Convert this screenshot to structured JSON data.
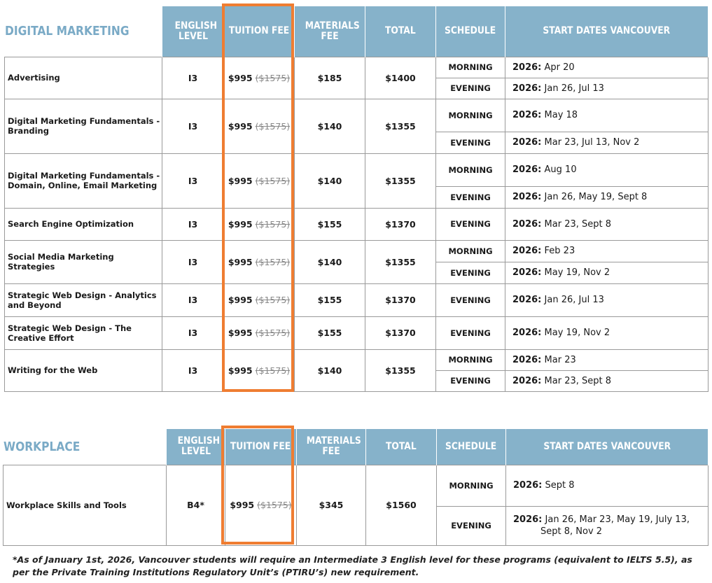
{
  "section1": {
    "title": "DIGITAL MARKETING",
    "headers": [
      "ENGLISH LEVEL",
      "TUITION FEE",
      "MATERIALS FEE",
      "TOTAL",
      "SCHEDULE",
      "START DATES VANCOUVER"
    ],
    "rows": [
      {
        "name": "Advertising",
        "level": "I3",
        "fee": "$995",
        "old_fee": "($1575)",
        "materials": "$185",
        "total": "$1400",
        "schedule": [
          {
            "time": "MORNING",
            "year": "2026:",
            "dates": "Apr 20"
          },
          {
            "time": "EVENING",
            "year": "2026:",
            "dates": "Jan 26, Jul 13"
          }
        ]
      },
      {
        "name": "Digital Marketing Fundamentals - Branding",
        "level": "I3",
        "fee": "$995",
        "old_fee": "($1575)",
        "materials": "$140",
        "total": "$1355",
        "schedule": [
          {
            "time": "MORNING",
            "year": "2026:",
            "dates": "May 18"
          },
          {
            "time": "EVENING",
            "year": "2026:",
            "dates": "Mar 23, Jul 13, Nov 2"
          }
        ]
      },
      {
        "name": "Digital Marketing Fundamentals - Domain, Online, Email Marketing",
        "level": "I3",
        "fee": "$995",
        "old_fee": "($1575)",
        "materials": "$140",
        "total": "$1355",
        "schedule": [
          {
            "time": "MORNING",
            "year": "2026:",
            "dates": "Aug 10"
          },
          {
            "time": "EVENING",
            "year": "2026:",
            "dates": "Jan 26, May 19, Sept 8"
          }
        ]
      },
      {
        "name": "Search Engine Optimization",
        "level": "I3",
        "fee": "$995",
        "old_fee": "($1575)",
        "materials": "$155",
        "total": "$1370",
        "schedule": [
          {
            "time": "EVENING",
            "year": "2026:",
            "dates": "Mar 23, Sept 8"
          }
        ]
      },
      {
        "name": "Social Media Marketing Strategies",
        "level": "I3",
        "fee": "$995",
        "old_fee": "($1575)",
        "materials": "$140",
        "total": "$1355",
        "schedule": [
          {
            "time": "MORNING",
            "year": "2026:",
            "dates": "Feb 23"
          },
          {
            "time": "EVENING",
            "year": "2026:",
            "dates": "May 19, Nov 2"
          }
        ]
      },
      {
        "name": "Strategic Web Design - Analytics and Beyond",
        "level": "I3",
        "fee": "$995",
        "old_fee": "($1575)",
        "materials": "$155",
        "total": "$1370",
        "schedule": [
          {
            "time": "EVENING",
            "year": "2026:",
            "dates": "Jan 26, Jul 13"
          }
        ]
      },
      {
        "name": "Strategic Web Design - The Creative Effort",
        "level": "I3",
        "fee": "$995",
        "old_fee": "($1575)",
        "materials": "$155",
        "total": "$1370",
        "schedule": [
          {
            "time": "EVENING",
            "year": "2026:",
            "dates": "May 19, Nov 2"
          }
        ]
      },
      {
        "name": "Writing for the Web",
        "level": "I3",
        "fee": "$995",
        "old_fee": "($1575)",
        "materials": "$140",
        "total": "$1355",
        "schedule": [
          {
            "time": "MORNING",
            "year": "2026:",
            "dates": "Mar 23"
          },
          {
            "time": "EVENING",
            "year": "2026:",
            "dates": "Mar 23, Sept 8"
          }
        ]
      }
    ]
  },
  "section2": {
    "title": "WORKPLACE",
    "headers": [
      "ENGLISH LEVEL",
      "TUITION FEE",
      "MATERIALS FEE",
      "TOTAL",
      "SCHEDULE",
      "START DATES VANCOUVER"
    ],
    "rows": [
      {
        "name": "Workplace Skills and Tools",
        "level": "B4*",
        "fee": "$995",
        "old_fee": "($1575)",
        "materials": "$345",
        "total": "$1560",
        "schedule": [
          {
            "time": "MORNING",
            "year": "2026:",
            "dates": "Sept 8"
          },
          {
            "time": "EVENING",
            "year": "2026:",
            "dates": "Jan 26, Mar 23, May 19, July 13,",
            "dates2": "Sept 8, Nov 2"
          }
        ]
      }
    ]
  },
  "footnote": "*As of January 1st, 2026, Vancouver students will require an Intermediate 3 English level for these programs (equivalent to IELTS 5.5), as per the Private Training Institutions Regulatory Unit’s (PTIRU’s) new requirement.",
  "colors": {
    "header_bg": "#86b2ca",
    "title": "#7aaac6",
    "highlight": "#ef7d32"
  }
}
